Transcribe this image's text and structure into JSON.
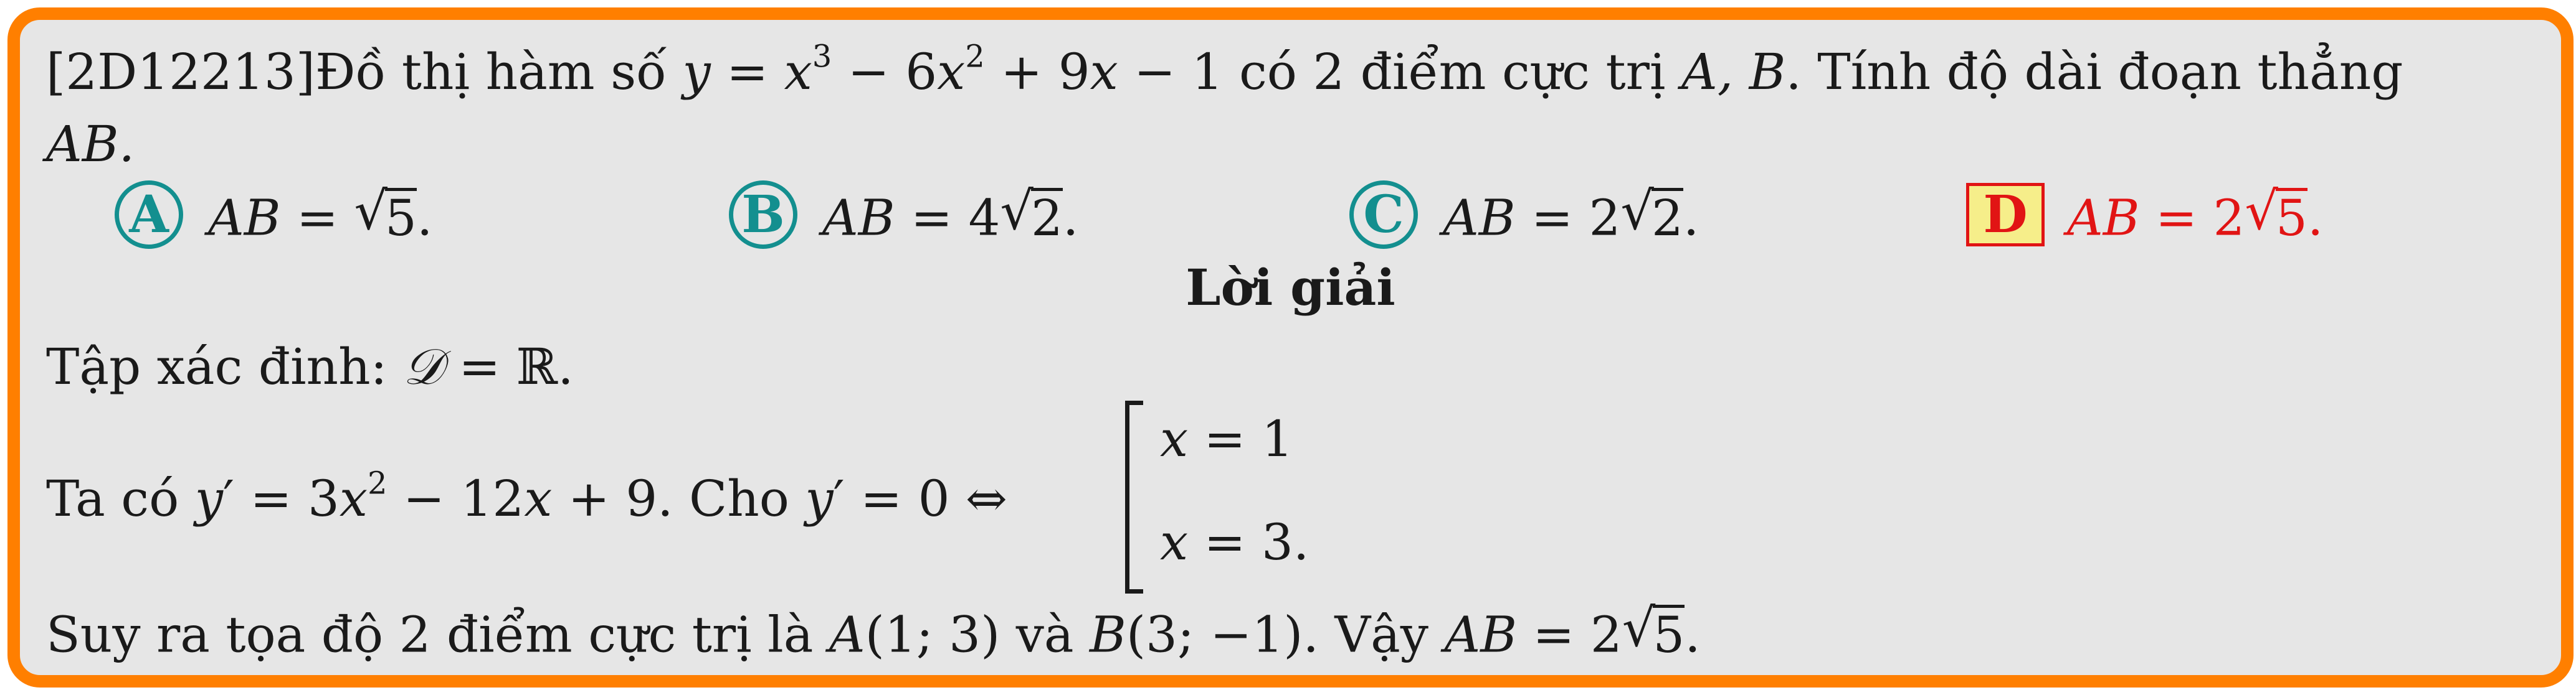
{
  "question": {
    "code": "[2D12213]",
    "text_before_y": "Đồ thị hàm số",
    "function": "y = x³ − 6x² + 9x − 1",
    "text_after_function": "có 2 điểm cực trị",
    "points": "A, B",
    "text_end_line1": ". Tính độ dài đoạn thẳng",
    "line2": "AB."
  },
  "options": [
    {
      "letter": "A",
      "lhs": "AB =",
      "value": "√5."
    },
    {
      "letter": "B",
      "lhs": "AB =",
      "value": "4√2."
    },
    {
      "letter": "C",
      "lhs": "AB =",
      "value": "2√2."
    },
    {
      "letter": "D",
      "lhs": "AB =",
      "value": "2√5.",
      "correct": true
    }
  ],
  "solution": {
    "heading": "Lời giải",
    "line1_text": "Tập xác đinh:",
    "line1_math": "𝒟 = ℝ.",
    "line2_text1": "Ta có",
    "line2_math1": "y′ = 3x² − 12x + 9",
    "line2_text2": ". Cho",
    "line2_math2": "y′ = 0 ⇔",
    "case1": "x = 1",
    "case2": "x = 3.",
    "line3_text1": "Suy ra tọa độ 2 điểm cực trị là",
    "pointA": "A(1; 3)",
    "line3_and": "và",
    "pointB": "B(3; −1)",
    "line3_text2": ". Vậy",
    "line3_math": "AB = 2√5."
  },
  "colors": {
    "border": "#ff7f00",
    "background": "#e6e6e6",
    "option_accent": "#138f8f",
    "correct_accent": "#e11414",
    "correct_fill": "#f6ee8a"
  }
}
